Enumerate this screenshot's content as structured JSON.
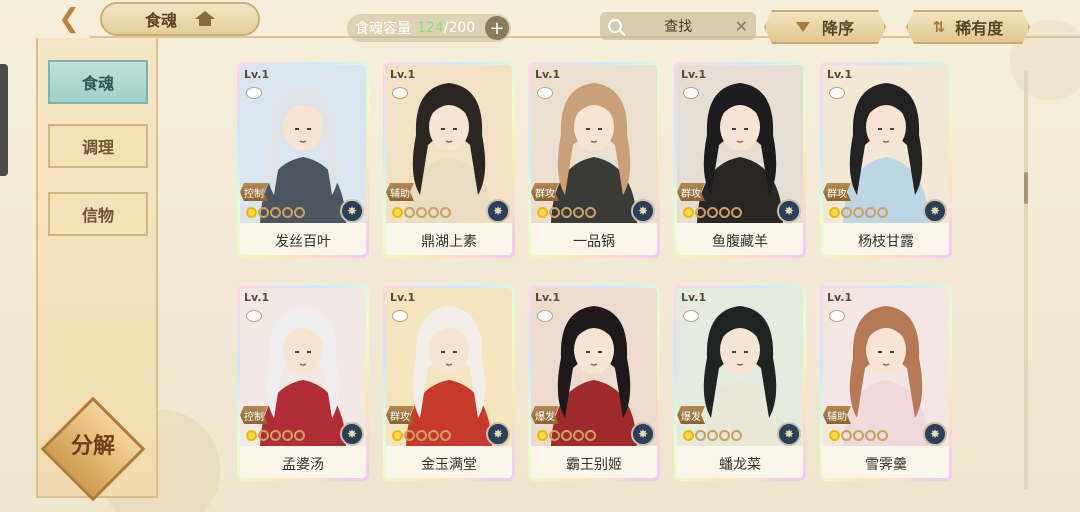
{
  "header": {
    "title": "食魂",
    "capacity_label": "食魂容量",
    "capacity_used": "124",
    "capacity_total": "/200",
    "search_placeholder": "查找",
    "sort_desc_label": "降序",
    "sort_rarity_label": "稀有度"
  },
  "sidebar": {
    "tabs": [
      {
        "label": "食魂",
        "active": true
      },
      {
        "label": "调理",
        "active": false
      },
      {
        "label": "信物",
        "active": false
      }
    ],
    "decompose_label": "分解"
  },
  "cards": [
    {
      "level": "Lv.1",
      "name": "发丝百叶",
      "role": "控制",
      "hair": "#dfe3e8",
      "robe": "#4d5560",
      "bg": "#d9e6f0"
    },
    {
      "level": "Lv.1",
      "name": "鼎湖上素",
      "role": "辅助",
      "hair": "#2a2622",
      "robe": "#e8dcc2",
      "bg": "#f0e2c2"
    },
    {
      "level": "Lv.1",
      "name": "一品锅",
      "role": "群攻",
      "hair": "#c9a07a",
      "robe": "#3a3a38",
      "bg": "#e9e0cf"
    },
    {
      "level": "Lv.1",
      "name": "鱼腹藏羊",
      "role": "群攻",
      "hair": "#1c1c1e",
      "robe": "#2a2626",
      "bg": "#e6ddd3"
    },
    {
      "level": "Lv.1",
      "name": "杨枝甘露",
      "role": "群攻",
      "hair": "#222",
      "robe": "#bcd6e6",
      "bg": "#f1e8d6"
    },
    {
      "level": "Lv.1",
      "name": "孟婆汤",
      "role": "控制",
      "hair": "#eeeeee",
      "robe": "#b02d35",
      "bg": "#f3e9e4"
    },
    {
      "level": "Lv.1",
      "name": "金玉满堂",
      "role": "群攻",
      "hair": "#f2efe8",
      "robe": "#c7392a",
      "bg": "#f6e6c0"
    },
    {
      "level": "Lv.1",
      "name": "霸王别姬",
      "role": "爆发",
      "hair": "#1e1a1c",
      "robe": "#9f2a2a",
      "bg": "#ecdccf"
    },
    {
      "level": "Lv.1",
      "name": "蟠龙菜",
      "role": "爆发",
      "hair": "#1e2422",
      "robe": "#e9e7d8",
      "bg": "#e6ebe0"
    },
    {
      "level": "Lv.1",
      "name": "雪霁羹",
      "role": "辅助",
      "hair": "#b57a55",
      "robe": "#efd9db",
      "bg": "#f4e6e2"
    }
  ],
  "colors": {
    "accent": "#c9ad72",
    "active_tab": "#9dd0c7"
  }
}
